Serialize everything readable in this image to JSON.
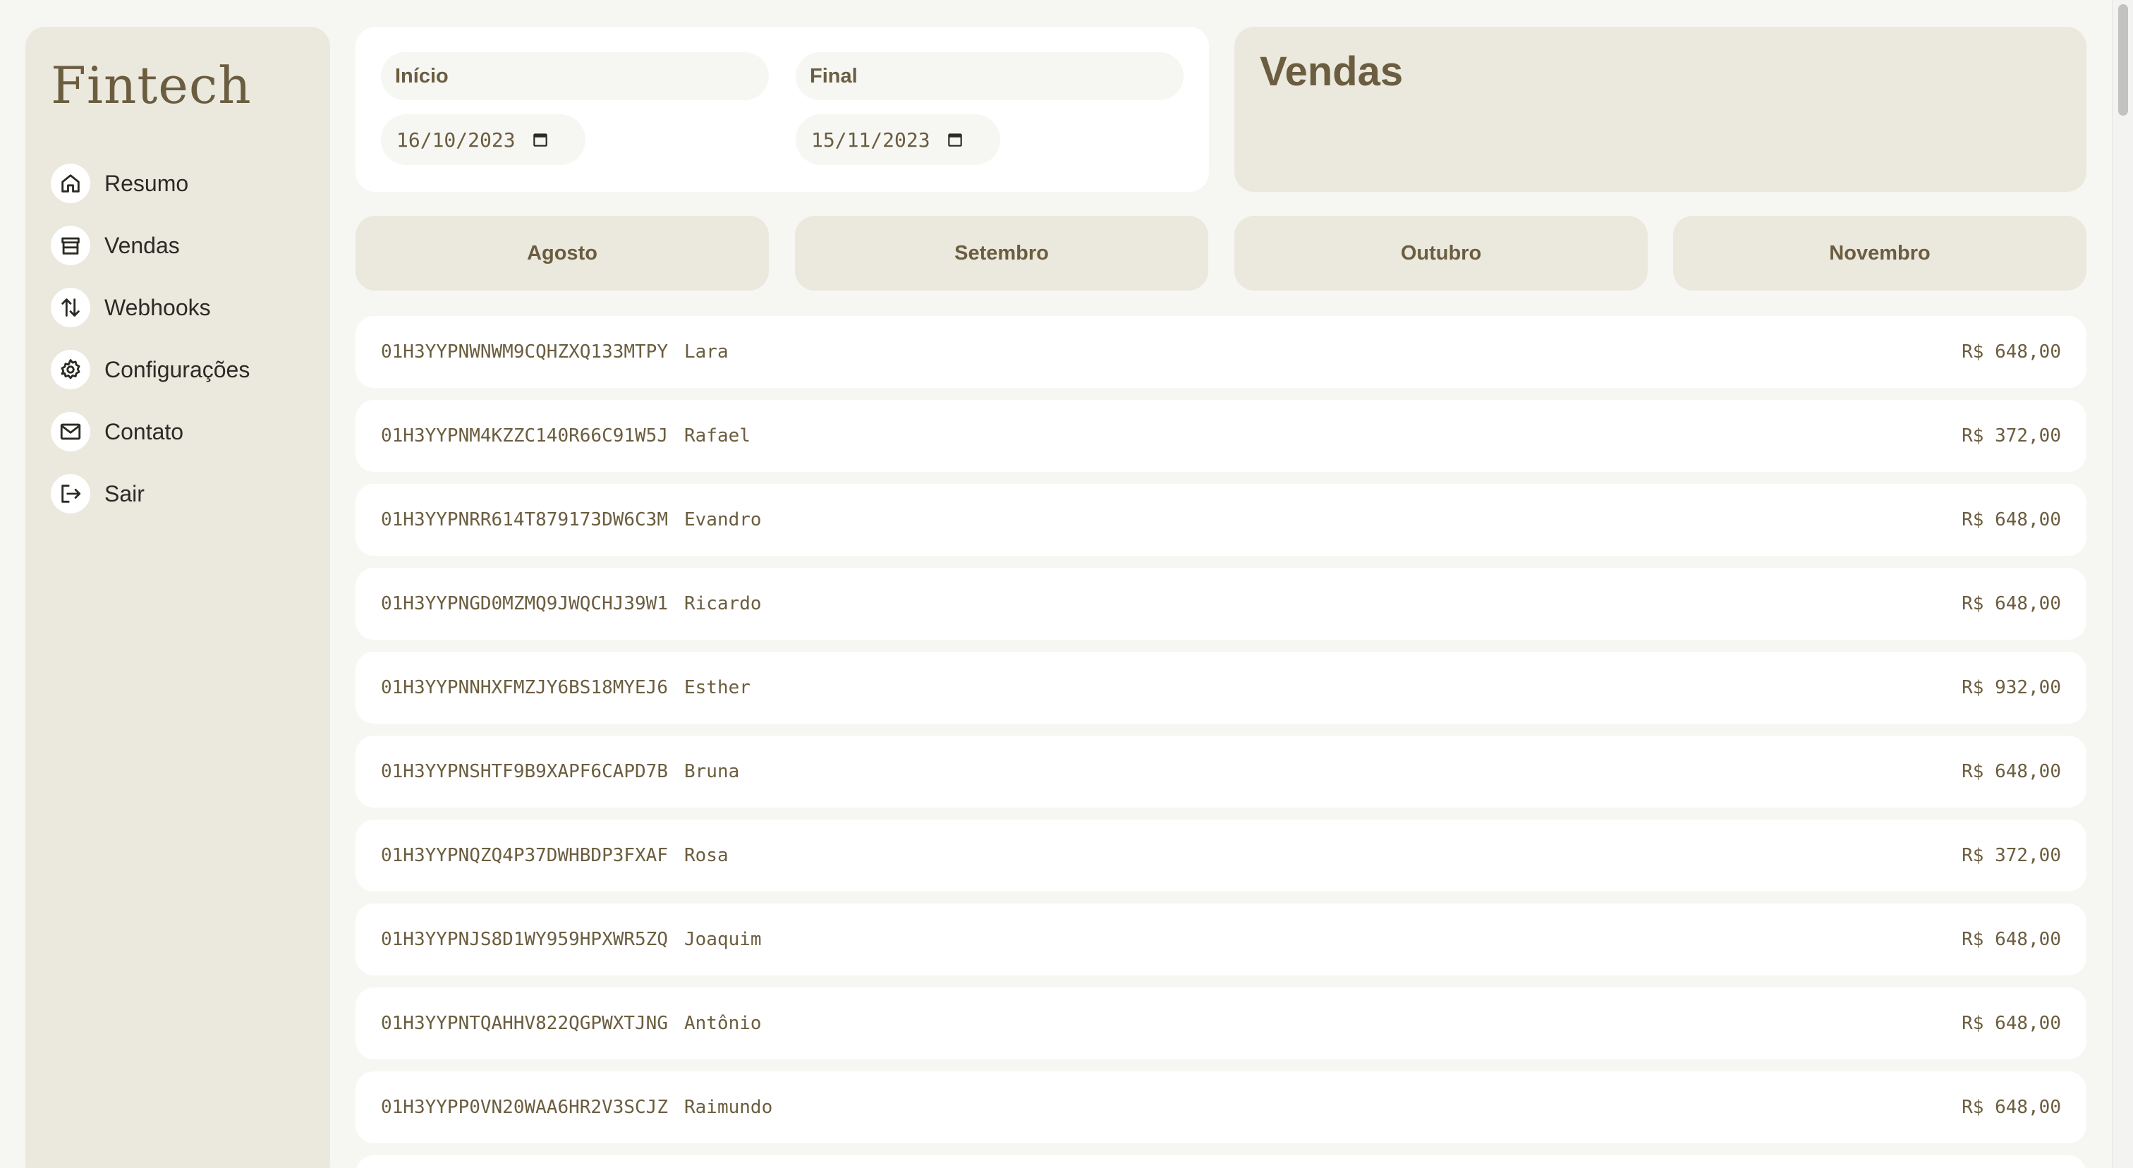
{
  "sidebar": {
    "logo": "Fintech",
    "items": [
      {
        "label": "Resumo",
        "icon": "home-icon"
      },
      {
        "label": "Vendas",
        "icon": "store-icon"
      },
      {
        "label": "Webhooks",
        "icon": "arrows-up-down-icon"
      },
      {
        "label": "Configurações",
        "icon": "gear-icon"
      },
      {
        "label": "Contato",
        "icon": "mail-icon"
      },
      {
        "label": "Sair",
        "icon": "logout-icon"
      }
    ]
  },
  "filters": {
    "start": {
      "label": "Início",
      "value": "16/10/2023"
    },
    "end": {
      "label": "Final",
      "value": "15/11/2023"
    }
  },
  "page_title": "Vendas",
  "months": [
    "Agosto",
    "Setembro",
    "Outubro",
    "Novembro"
  ],
  "sales": [
    {
      "id": "01H3YYPNWNWM9CQHZXQ133MTPY",
      "name": "Lara",
      "price": "R$ 648,00"
    },
    {
      "id": "01H3YYPNM4KZZC140R66C91W5J",
      "name": "Rafael",
      "price": "R$ 372,00"
    },
    {
      "id": "01H3YYPNRR614T879173DW6C3M",
      "name": "Evandro",
      "price": "R$ 648,00"
    },
    {
      "id": "01H3YYPNGD0MZMQ9JWQCHJ39W1",
      "name": "Ricardo",
      "price": "R$ 648,00"
    },
    {
      "id": "01H3YYPNNHXFMZJY6BS18MYEJ6",
      "name": "Esther",
      "price": "R$ 932,00"
    },
    {
      "id": "01H3YYPNSHTF9B9XAPF6CAPD7B",
      "name": "Bruna",
      "price": "R$ 648,00"
    },
    {
      "id": "01H3YYPNQZQ4P37DWHBDP3FXAF",
      "name": "Rosa",
      "price": "R$ 372,00"
    },
    {
      "id": "01H3YYPNJS8D1WY959HPXWR5ZQ",
      "name": "Joaquim",
      "price": "R$ 648,00"
    },
    {
      "id": "01H3YYPNTQAHHV822QGPWXTJNG",
      "name": "Antônio",
      "price": "R$ 648,00"
    },
    {
      "id": "01H3YYPP0VN20WAA6HR2V3SCJZ",
      "name": "Raimundo",
      "price": "R$ 648,00"
    }
  ],
  "colors": {
    "accent": "#6b5d3f",
    "panel": "#ebe8de",
    "background": "#f6f6f3",
    "card": "#ffffff"
  }
}
